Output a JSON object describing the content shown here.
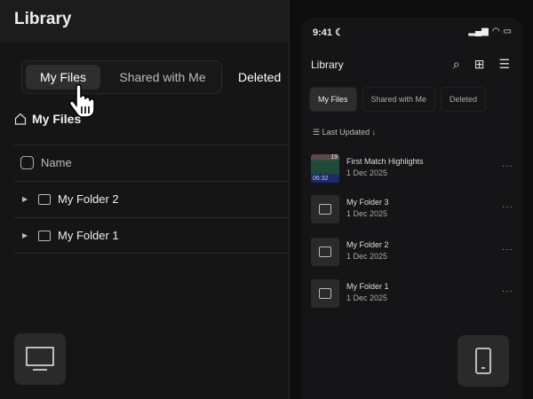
{
  "desktop": {
    "title": "Library",
    "tabs": [
      "My Files",
      "Shared with Me",
      "Deleted"
    ],
    "breadcrumb": "My Files",
    "column_name": "Name",
    "rows": [
      "My Folder 2",
      "My Folder 1"
    ]
  },
  "mobile": {
    "time": "9:41",
    "title": "Library",
    "tabs": [
      "My Files",
      "Shared with Me",
      "Deleted"
    ],
    "sort_label": "Last Updated",
    "items": [
      {
        "name": "First Match Highlights",
        "date": "1 Dec 2025",
        "type": "video",
        "duration": "06:32",
        "count": "19"
      },
      {
        "name": "My Folder 3",
        "date": "1 Dec 2025",
        "type": "folder"
      },
      {
        "name": "My Folder 2",
        "date": "1 Dec 2025",
        "type": "folder"
      },
      {
        "name": "My Folder 1",
        "date": "1 Dec 2025",
        "type": "folder"
      }
    ],
    "more": "···"
  }
}
